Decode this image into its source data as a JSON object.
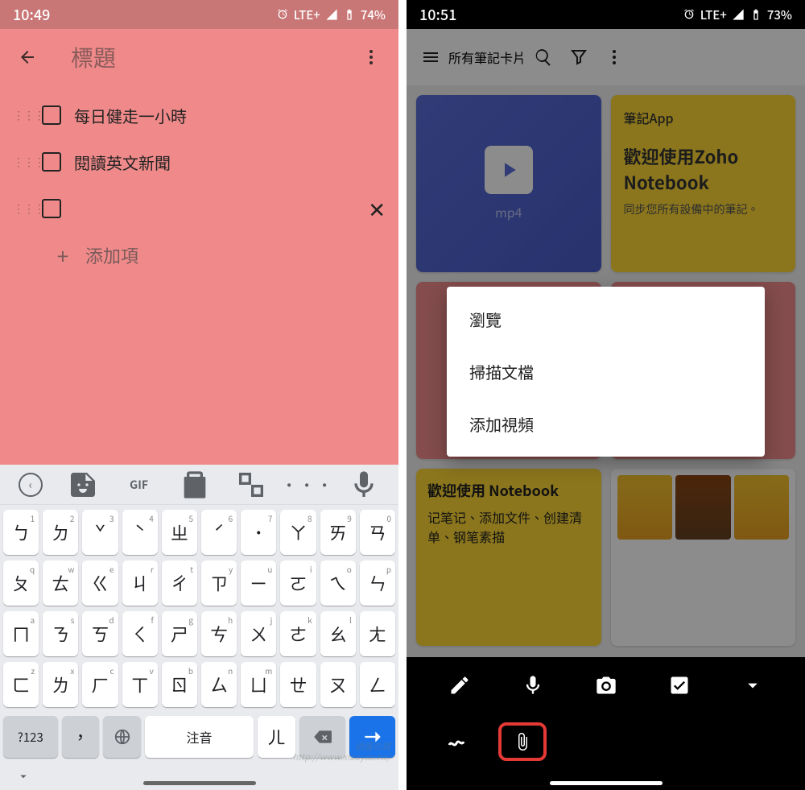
{
  "left": {
    "status": {
      "time": "10:49",
      "network": "LTE+",
      "battery": "74%"
    },
    "appbar": {
      "title": "標題"
    },
    "checklist": {
      "items": [
        {
          "text": "每日健走一小時"
        },
        {
          "text": "閱讀英文新聞"
        },
        {
          "text": ""
        }
      ],
      "add_label": "添加項"
    },
    "keyboard": {
      "toolbar_gif": "GIF",
      "rows": [
        [
          {
            "main": "ㄅ",
            "sup": "1"
          },
          {
            "main": "ㄉ",
            "sup": "2"
          },
          {
            "main": "ˇ",
            "sup": "3"
          },
          {
            "main": "ˋ",
            "sup": "4"
          },
          {
            "main": "ㄓ",
            "sup": "5"
          },
          {
            "main": "ˊ",
            "sup": "6"
          },
          {
            "main": "˙",
            "sup": "7"
          },
          {
            "main": "ㄚ",
            "sup": "8"
          },
          {
            "main": "ㄞ",
            "sup": "9"
          },
          {
            "main": "ㄢ",
            "sup": "0"
          }
        ],
        [
          {
            "main": "ㄆ",
            "sup": "q"
          },
          {
            "main": "ㄊ",
            "sup": "w"
          },
          {
            "main": "ㄍ",
            "sup": "e"
          },
          {
            "main": "ㄐ",
            "sup": "r"
          },
          {
            "main": "ㄔ",
            "sup": "t"
          },
          {
            "main": "ㄗ",
            "sup": "y"
          },
          {
            "main": "ㄧ",
            "sup": "u"
          },
          {
            "main": "ㄛ",
            "sup": "i"
          },
          {
            "main": "ㄟ",
            "sup": "o"
          },
          {
            "main": "ㄣ",
            "sup": "p"
          }
        ],
        [
          {
            "main": "ㄇ",
            "sup": "a"
          },
          {
            "main": "ㄋ",
            "sup": "s"
          },
          {
            "main": "ㄎ",
            "sup": "d"
          },
          {
            "main": "ㄑ",
            "sup": "f"
          },
          {
            "main": "ㄕ",
            "sup": "g"
          },
          {
            "main": "ㄘ",
            "sup": "h"
          },
          {
            "main": "ㄨ",
            "sup": "j"
          },
          {
            "main": "ㄜ",
            "sup": "k"
          },
          {
            "main": "ㄠ",
            "sup": "l"
          },
          {
            "main": "ㄤ",
            "sup": ""
          }
        ],
        [
          {
            "main": "ㄈ",
            "sup": "z"
          },
          {
            "main": "ㄌ",
            "sup": "x"
          },
          {
            "main": "ㄏ",
            "sup": "c"
          },
          {
            "main": "ㄒ",
            "sup": "v"
          },
          {
            "main": "ㄖ",
            "sup": "b"
          },
          {
            "main": "ㄙ",
            "sup": "n"
          },
          {
            "main": "ㄩ",
            "sup": "m"
          },
          {
            "main": "ㄝ",
            "sup": ""
          },
          {
            "main": "ㄡ",
            "sup": ""
          },
          {
            "main": "ㄥ",
            "sup": ""
          }
        ]
      ],
      "bottom": {
        "sym": "?123",
        "comma": "，",
        "space": "注音",
        "er": "ㄦ"
      }
    }
  },
  "right": {
    "status": {
      "time": "10:51",
      "network": "LTE+",
      "battery": "73%"
    },
    "appbar": {
      "title": "所有筆記卡片"
    },
    "cards": {
      "mp4_label": "mp4",
      "welcome_tag": "筆記App",
      "welcome_title": "歡迎使用Zoho Notebook",
      "welcome_sub": "同步您所有設備中的筆記。",
      "guide_title": "歡迎使用 Notebook",
      "guide_sub": "记笔记、添加文件、创建清单、钢笔素描"
    },
    "popup": {
      "items": [
        "瀏覽",
        "掃描文檔",
        "添加視頻"
      ]
    }
  },
  "watermark": "逍遙の窩\nhttp://www.xiaoyao.tw/"
}
